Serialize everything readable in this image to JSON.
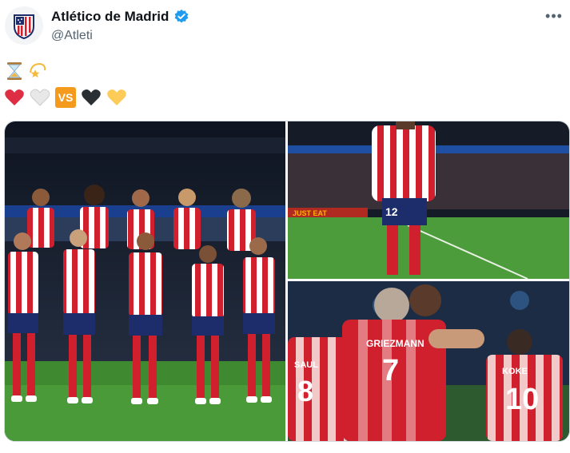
{
  "tweet": {
    "author_name": "Atlético de Madrid",
    "handle": "@Atleti",
    "verified": true,
    "body_line1": [
      "hourglass",
      "dizzy-star"
    ],
    "body_line2": [
      "red-heart",
      "white-heart",
      "vs",
      "black-heart",
      "yellow-heart"
    ],
    "vs_label": "VS"
  },
  "photos": {
    "photo2_ad": "JUST EAT",
    "photo2_number": "12",
    "photo3_name_left": "SAUL",
    "photo3_name_center": "GRIEZMANN",
    "photo3_name_right": "KOKE",
    "photo3_number_center": "7",
    "photo3_number_left": "8",
    "photo3_number_right": "10"
  },
  "colors": {
    "verified": "#1d9bf0",
    "atleti_red": "#d0202e",
    "atleti_navy": "#1d2d6b",
    "pitch": "#4a9a3a"
  }
}
